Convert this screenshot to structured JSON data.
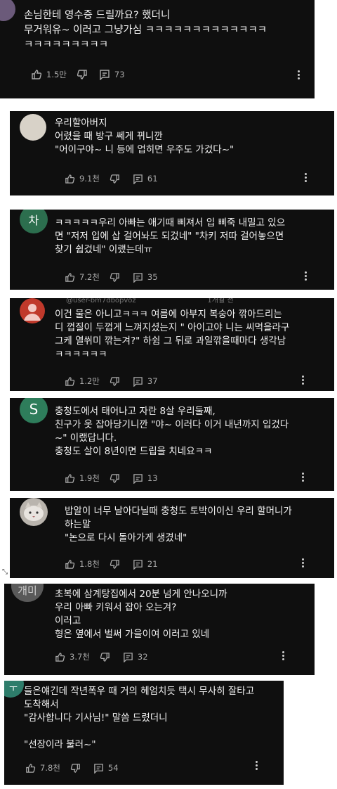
{
  "comments": [
    {
      "text": "손님한테 영수증 드릴까요? 했더니\n무거워유~ 이러고 그냥가심 ㅋㅋㅋㅋㅋㅋㅋㅋㅋㅋㅋㅋㅋ\nㅋㅋㅋㅋㅋㅋㅋㅋㅋ",
      "likes": "1.5만",
      "replies": "73",
      "avatar_color": "#6b5a7a"
    },
    {
      "text": "우리할아버지\n어렸을 때 방구 쎄게 뀌니깐\n\"어이구야~ 니 등에 업히면 우주도 가겄다~\"",
      "likes": "9.1천",
      "replies": "61",
      "avatar_color": "#d8d2c8"
    },
    {
      "text": "ㅋㅋㅋㅋㅋ우리 아빠는 애기때 삐져서 입 삐죽 내밀고 있으\n면 \"저저 입에 삽 걸어놔도 되겄네\" \"차키 저따 걸어놓으면\n찾기 쉽겄네\" 이랬는데ㅠ",
      "likes": "7.2천",
      "replies": "35",
      "avatar_letter": "차",
      "avatar_color": "#2c6e4e"
    },
    {
      "text": "이건 물은 아니고ㅋㅋㅋ 여름에 아부지 복숭아 깎아드리는\n디 껍질이 두껍게 느껴지셨는지 \" 아이고야 니는 씨먹을라구\n그케 열쒸미 깎는겨?\" 하쉼 그 뒤로 과일깎을때마다 생각남\nㅋㅋㅋㅋㅋㅋ",
      "likes": "1.2만",
      "replies": "37",
      "avatar_color": "#c0392b",
      "topline": "@user-bm7dbopvoz                                1개월 전"
    },
    {
      "text": "충청도에서 태어나고 자란 8살 우리둘째,\n친구가 옷 잡아당기니깐 \"야~ 이러다 이거 내년까지 입겄다\n~\" 이랬답니다.\n충청도 살이 8년이면 드립을 치네요ㅋㅋ",
      "likes": "1.9천",
      "replies": "13",
      "avatar_letter": "S",
      "avatar_color": "#2e7d5b"
    },
    {
      "text": "밥알이 너무 날아다닐때 충청도 토박이이신 우리 할머니가\n하는말\n\"논으로 다시 돌아가게 생겼네\"",
      "likes": "1.8천",
      "replies": "21",
      "avatar_color": "#b9b4ad"
    },
    {
      "text": "초복에 삼계탕집에서 20분 넘게 안나오니까\n우리 아빠 키워서 잡아 오는겨?\n이러고\n형은 옆에서 벌써 가을이여 이러고 있네",
      "likes": "3.7천",
      "replies": "32",
      "avatar_letter": "개미",
      "avatar_color": "#5a5a5a"
    },
    {
      "text": "들은얘긴데 작년폭우 때 거의 헤엄치듯 택시 무사히 잘타고\n도착해서\n\"감사합니다 기사님!\" 말씀 드렸더니\n\n\"선장이라 불러~\"",
      "likes": "7.8천",
      "replies": "54",
      "avatar_letter": "ㅜ",
      "avatar_color": "#2e7d6b"
    }
  ]
}
